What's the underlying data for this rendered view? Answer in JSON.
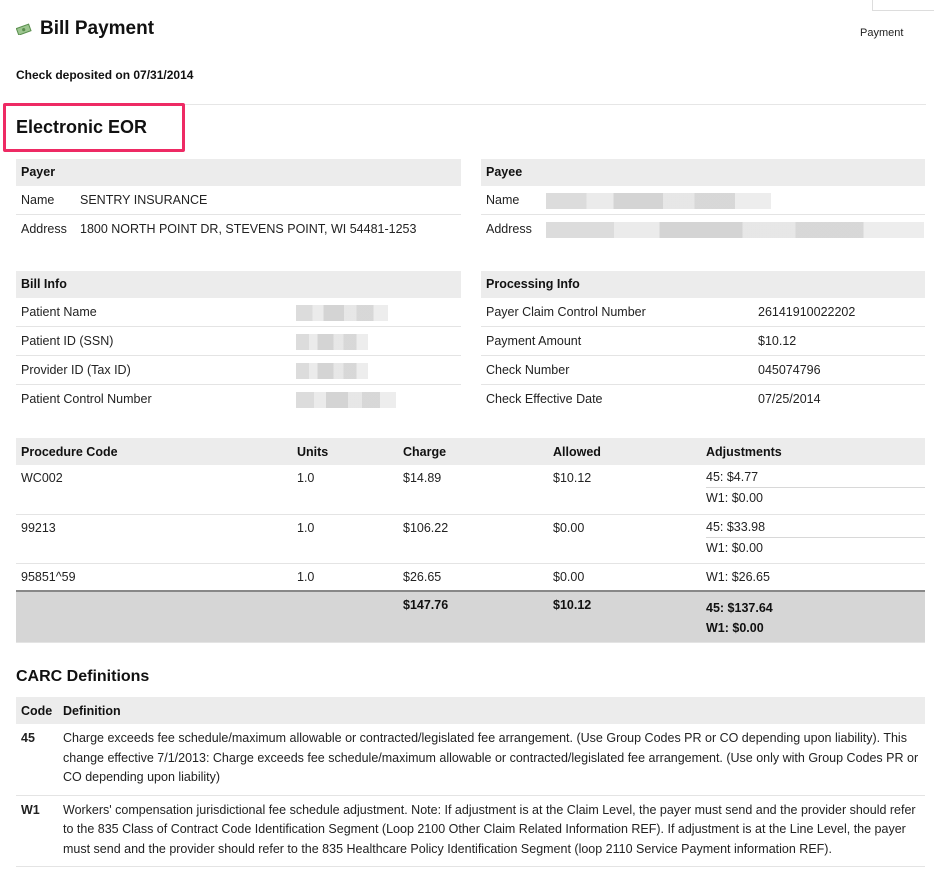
{
  "header": {
    "title": "Bill Payment",
    "icon": "money-icon",
    "breadcrumb": "Payment",
    "deposited_label": "Check deposited on",
    "deposited_date": "07/31/2014"
  },
  "eor_heading": "Electronic EOR",
  "colors": {
    "highlight": "#ee2a64",
    "header_bg": "#ececec",
    "total_bg": "#d6d6d6"
  },
  "payer": {
    "title": "Payer",
    "name_label": "Name",
    "name": "SENTRY INSURANCE",
    "address_label": "Address",
    "address": "1800 NORTH POINT DR, STEVENS POINT, WI 54481-1253"
  },
  "payee": {
    "title": "Payee",
    "name_label": "Name",
    "address_label": "Address"
  },
  "bill_info": {
    "title": "Bill Info",
    "labels": [
      "Patient Name",
      "Patient ID (SSN)",
      "Provider ID (Tax ID)",
      "Patient Control Number"
    ]
  },
  "processing_info": {
    "title": "Processing Info",
    "rows": [
      {
        "label": "Payer Claim Control Number",
        "value": "26141910022202"
      },
      {
        "label": "Payment Amount",
        "value": "$10.12"
      },
      {
        "label": "Check Number",
        "value": "045074796"
      },
      {
        "label": "Check Effective Date",
        "value": "07/25/2014"
      }
    ]
  },
  "procedures": {
    "headers": [
      "Procedure Code",
      "Units",
      "Charge",
      "Allowed",
      "Adjustments"
    ],
    "rows": [
      {
        "code": "WC002",
        "units": "1.0",
        "charge": "$14.89",
        "allowed": "$10.12",
        "adj1": "45: $4.77",
        "adj2": "W1: $0.00"
      },
      {
        "code": "99213",
        "units": "1.0",
        "charge": "$106.22",
        "allowed": "$0.00",
        "adj1": "45: $33.98",
        "adj2": "W1: $0.00"
      },
      {
        "code": "95851^59",
        "units": "1.0",
        "charge": "$26.65",
        "allowed": "$0.00",
        "adj1": "W1: $26.65"
      }
    ],
    "total": {
      "charge": "$147.76",
      "allowed": "$10.12",
      "adj1": "45: $137.64",
      "adj2": "W1: $0.00"
    }
  },
  "carc": {
    "title": "CARC Definitions",
    "headers": [
      "Code",
      "Definition"
    ],
    "rows": [
      {
        "code": "45",
        "definition": "Charge exceeds fee schedule/maximum allowable or contracted/legislated fee arrangement. (Use Group Codes PR or CO depending upon liability). This change effective 7/1/2013: Charge exceeds fee schedule/maximum allowable or contracted/legislated fee arrangement. (Use only with Group Codes PR or CO depending upon liability)"
      },
      {
        "code": "W1",
        "definition": "Workers' compensation jurisdictional fee schedule adjustment. Note: If adjustment is at the Claim Level, the payer must send and the provider should refer to the 835 Class of Contract Code Identification Segment (Loop 2100 Other Claim Related Information REF). If adjustment is at the Line Level, the payer must send and the provider should refer to the 835 Healthcare Policy Identification Segment (loop 2110 Service Payment information REF)."
      }
    ]
  }
}
